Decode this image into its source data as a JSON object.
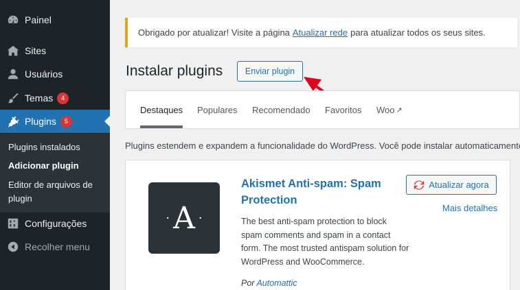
{
  "sidebar": {
    "items": [
      {
        "label": "Painel",
        "icon": "dashboard-icon"
      },
      {
        "label": "Sites",
        "icon": "sites-icon"
      },
      {
        "label": "Usuários",
        "icon": "user-icon"
      },
      {
        "label": "Temas",
        "icon": "brush-icon",
        "badge": "4"
      },
      {
        "label": "Plugins",
        "icon": "plugin-icon",
        "badge": "5"
      },
      {
        "label": "Configurações",
        "icon": "settings-icon"
      },
      {
        "label": "Recolher menu",
        "icon": "collapse-icon"
      }
    ],
    "submenu": [
      {
        "label": "Plugins instalados"
      },
      {
        "label": "Adicionar plugin"
      },
      {
        "label": "Editor de arquivos de plugin"
      }
    ]
  },
  "notice": {
    "before": "Obrigado por atualizar! Visite a página",
    "link": "Atualizar rede",
    "after": "para atualizar todos os seus sites."
  },
  "page": {
    "title": "Instalar plugins",
    "upload_label": "Enviar plugin"
  },
  "tabs": [
    {
      "label": "Destaques"
    },
    {
      "label": "Populares"
    },
    {
      "label": "Recomendado"
    },
    {
      "label": "Favoritos"
    },
    {
      "label": "Woo"
    }
  ],
  "description": "Plugins estendem e expandem a funcionalidade do WordPress. Você pode instalar automaticamente",
  "plugin": {
    "icon_letter": "A",
    "name": "Akismet Anti-spam: Spam Protection",
    "update_label": "Atualizar agora",
    "more_label": "Mais detalhes",
    "description": "The best anti-spam protection to block spam comments and spam in a contact form. The most trusted antispam solution for WordPress and WooCommerce.",
    "author_prefix": "Por",
    "author": "Automattic"
  },
  "colors": {
    "sidebar_bg": "#1d2327",
    "accent": "#2271b1",
    "badge": "#d63638",
    "notice_border": "#dba617",
    "arrow": "#e0001b"
  }
}
